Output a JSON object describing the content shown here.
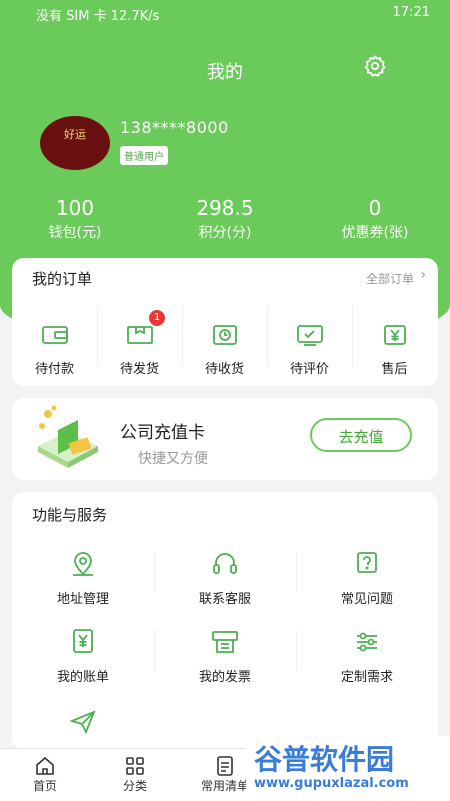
{
  "status_bar": {
    "left": "没有 SIM 卡  12.7K/s",
    "time": "17:21"
  },
  "header": {
    "title": "我的",
    "avatar_text": "好运",
    "phone": "138****8000",
    "user_level": "普通用户"
  },
  "stats": [
    {
      "value": "100",
      "label": "钱包(元)"
    },
    {
      "value": "298.5",
      "label": "积分(分)"
    },
    {
      "value": "0",
      "label": "优惠券(张)"
    }
  ],
  "orders": {
    "title": "我的订单",
    "all_label": "全部订单",
    "items": [
      {
        "label": "待付款",
        "icon": "wallet-icon"
      },
      {
        "label": "待发货",
        "icon": "package-icon",
        "badge": "1"
      },
      {
        "label": "待收货",
        "icon": "clock-box-icon"
      },
      {
        "label": "待评价",
        "icon": "comment-check-icon"
      },
      {
        "label": "售后",
        "icon": "yen-doc-icon"
      }
    ]
  },
  "recharge": {
    "title": "公司充值卡",
    "subtitle": "快捷又方便",
    "button": "去充值"
  },
  "services": {
    "title": "功能与服务",
    "items": [
      {
        "label": "地址管理",
        "icon": "location-pin-icon"
      },
      {
        "label": "联系客服",
        "icon": "headset-icon"
      },
      {
        "label": "常见问题",
        "icon": "question-icon"
      },
      {
        "label": "我的账单",
        "icon": "bill-icon"
      },
      {
        "label": "我的发票",
        "icon": "invoice-icon"
      },
      {
        "label": "定制需求",
        "icon": "sliders-icon"
      },
      {
        "label": "",
        "icon": "send-icon"
      }
    ]
  },
  "tabbar": [
    {
      "label": "首页",
      "icon": "home-icon"
    },
    {
      "label": "分类",
      "icon": "grid-icon"
    },
    {
      "label": "常用清单",
      "icon": "list-icon"
    }
  ],
  "watermark": {
    "title": "谷普软件园",
    "url": "www.gupuxlazal.com"
  },
  "colors": {
    "primary": "#6bcb5a",
    "badge": "#e53935"
  }
}
